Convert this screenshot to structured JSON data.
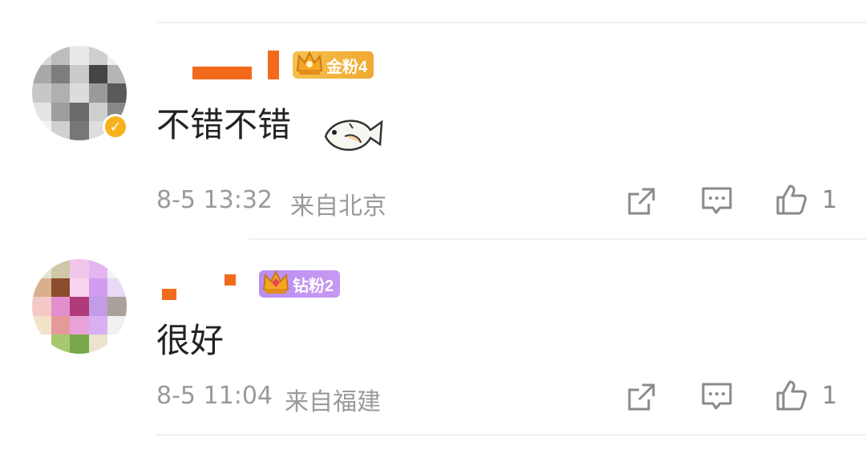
{
  "comments": [
    {
      "text": "不错不错",
      "badge": "金粉4",
      "time": "8-5 13:32",
      "location": "来自北京",
      "like_count": "1"
    },
    {
      "text": "很好",
      "badge": "钻粉2",
      "time": "8-5 11:04",
      "location": "来自福建",
      "like_count": "1"
    }
  ],
  "colors": {
    "gold_badge": "#f6b33a",
    "diamond_badge": "#c08cf0",
    "name_redaction": "#f26b1d",
    "meta_text": "#9a9a9a"
  },
  "icons": [
    "share-icon",
    "comment-icon",
    "like-icon",
    "fish-sticker",
    "verified-icon",
    "crown-icon"
  ]
}
